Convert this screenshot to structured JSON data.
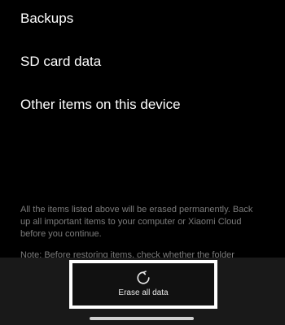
{
  "list": {
    "items": [
      {
        "label": "Backups"
      },
      {
        "label": "SD card data"
      },
      {
        "label": "Other items on this device"
      }
    ]
  },
  "notice": {
    "text": "All the items listed above will be erased permanently. Back up all important items to your computer or Xiaomi Cloud before you continue.",
    "note": "Note: Before restoring items, check whether the folder"
  },
  "action": {
    "erase_label": "Erase all data",
    "icon": "refresh-icon"
  }
}
